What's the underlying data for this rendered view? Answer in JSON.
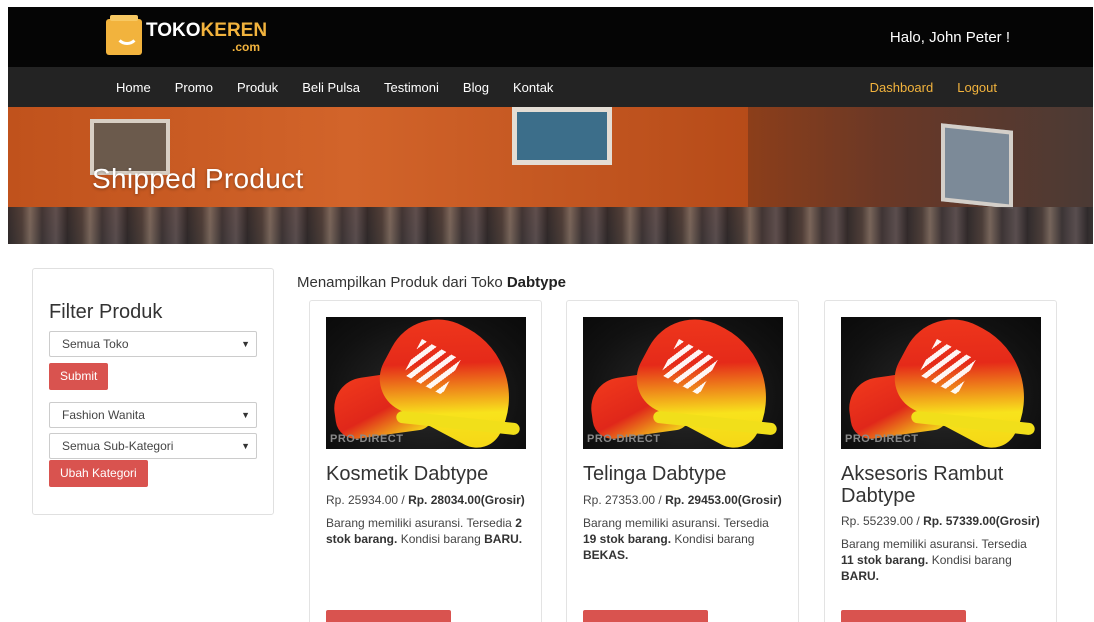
{
  "header": {
    "logo": {
      "word1": "TOKO",
      "word2": "KEREN",
      "suffix": ".com",
      "icon": "shopping-bag-icon"
    },
    "greeting": "Halo, John Peter !"
  },
  "nav": {
    "left": [
      "Home",
      "Promo",
      "Produk",
      "Beli Pulsa",
      "Testimoni",
      "Blog",
      "Kontak"
    ],
    "right": [
      "Dashboard",
      "Logout"
    ]
  },
  "hero": {
    "title": "Shipped Product"
  },
  "filter": {
    "title": "Filter Produk",
    "store_select": "Semua Toko",
    "submit": "Submit",
    "category_select": "Fashion Wanita",
    "subcategory_select": "Semua Sub-Kategori",
    "change_category": "Ubah Kategori",
    "caret": "▼"
  },
  "shop": {
    "prefix": "Menampilkan Produk dari Toko",
    "name": "Dabtype"
  },
  "products": [
    {
      "name": "Kosmetik Dabtype",
      "price": "Rp. 25934.00 / ",
      "wholesale": "Rp. 28034.00(Grosir)",
      "desc_prefix": "Barang memiliki asuransi. Tersedia",
      "stock": "2 stok barang.",
      "desc_mid": "Kondisi barang",
      "condition": "BARU.",
      "watermark": "PRO-DIRECT"
    },
    {
      "name": "Telinga Dabtype",
      "price": "Rp. 27353.00 / ",
      "wholesale": "Rp. 29453.00(Grosir)",
      "desc_prefix": "Barang memiliki asuransi. Tersedia",
      "stock": "19 stok barang.",
      "desc_mid": "Kondisi barang",
      "condition": "BEKAS.",
      "watermark": "PRO-DIRECT"
    },
    {
      "name": "Aksesoris Rambut Dabtype",
      "price": "Rp. 55239.00 / ",
      "wholesale": "Rp. 57339.00(Grosir)",
      "desc_prefix": "Barang memiliki asuransi. Tersedia",
      "stock": "11 stok barang.",
      "desc_mid": "Kondisi barang",
      "condition": "BARU.",
      "watermark": "PRO-DIRECT"
    }
  ],
  "colors": {
    "accent": "#f2b33d",
    "danger": "#d9534f",
    "topbar": "#050505",
    "navbar": "#232323"
  }
}
